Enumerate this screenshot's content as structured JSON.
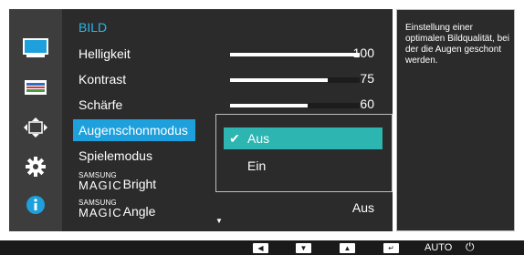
{
  "sidebar": {
    "items": [
      {
        "icon": "monitor-icon",
        "active": true
      },
      {
        "icon": "color-bars-icon",
        "active": false
      },
      {
        "icon": "resize-arrows-icon",
        "active": false
      },
      {
        "icon": "gear-icon",
        "active": false
      },
      {
        "icon": "info-icon",
        "active": false
      }
    ]
  },
  "menu": {
    "title": "BILD",
    "rows": [
      {
        "label": "Helligkeit",
        "value": "100",
        "level": 1.0
      },
      {
        "label": "Kontrast",
        "value": "75",
        "level": 0.75
      },
      {
        "label": "Schärfe",
        "value": "60",
        "level": 0.6
      },
      {
        "label": "Augenschonmodus",
        "selected": true
      },
      {
        "label": "Spielemodus"
      },
      {
        "magic_prefix": "SAMSUNG",
        "magic_mid": "MAGIC",
        "label": "Bright"
      },
      {
        "magic_prefix": "SAMSUNG",
        "magic_mid": "MAGIC",
        "label": "Angle",
        "value": "Aus"
      }
    ],
    "scroll_indicator": "▼"
  },
  "dropdown": {
    "options": [
      {
        "label": "Aus",
        "checked": true
      },
      {
        "label": "Ein",
        "checked": false
      }
    ],
    "check_glyph": "✔"
  },
  "help": {
    "text": "Einstellung einer optimalen Bildqualität, bei der die Augen geschont werden."
  },
  "bottom_bar": {
    "buttons": [
      {
        "icon": "left-arrow-icon",
        "glyph": "◀"
      },
      {
        "icon": "down-arrow-icon",
        "glyph": "▼"
      },
      {
        "icon": "up-arrow-icon",
        "glyph": "▲"
      },
      {
        "icon": "enter-icon",
        "glyph": "↵"
      },
      {
        "label": "AUTO"
      },
      {
        "icon": "power-icon",
        "glyph": "⏻"
      }
    ]
  },
  "colors": {
    "accent_blue": "#1ea0dc",
    "checked_teal": "#2cb5b1",
    "title_blue": "#29b6e6",
    "panel_bg": "#2b2b2b"
  }
}
